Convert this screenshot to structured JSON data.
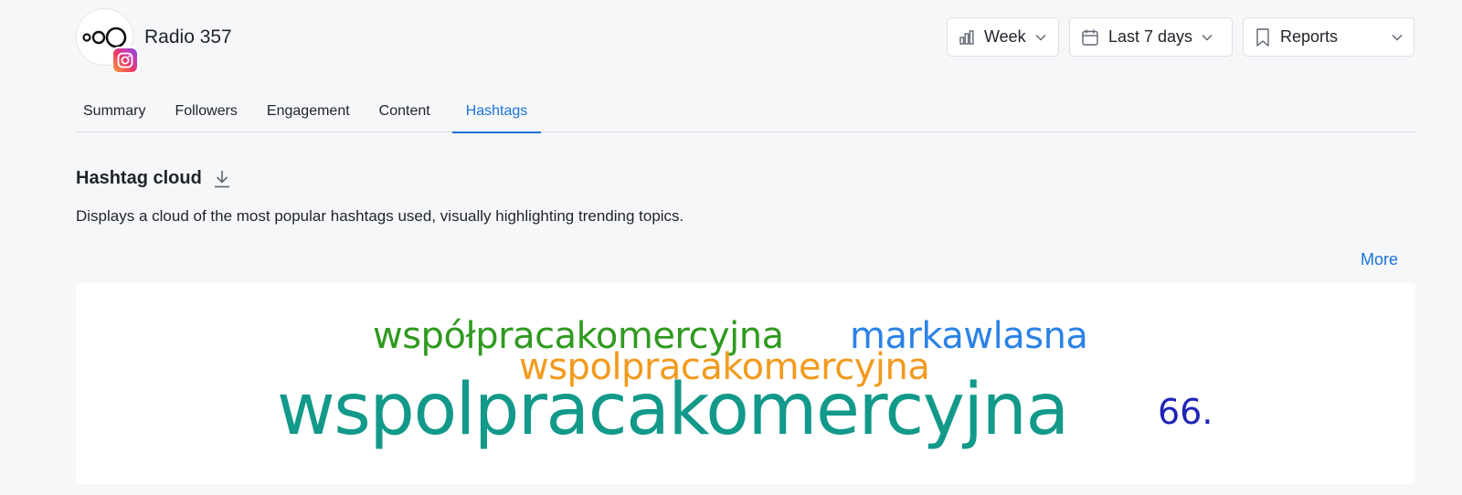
{
  "profile": {
    "name": "Radio 357",
    "avatar_icon": "radio357-logo-icon",
    "network_icon": "instagram-icon"
  },
  "controls": {
    "period": {
      "label": "Week",
      "icon": "bar-chart-icon"
    },
    "range": {
      "label": "Last 7 days",
      "icon": "calendar-icon"
    },
    "reports": {
      "label": "Reports",
      "icon": "bookmark-icon"
    }
  },
  "tabs": [
    {
      "label": "Summary",
      "active": false
    },
    {
      "label": "Followers",
      "active": false
    },
    {
      "label": "Engagement",
      "active": false
    },
    {
      "label": "Content",
      "active": false
    },
    {
      "label": "Hashtags",
      "active": true
    }
  ],
  "section": {
    "title": "Hashtag cloud",
    "description": "Displays a cloud of the most popular hashtags used, visually highlighting trending topics.",
    "more_label": "More"
  },
  "hashtag_cloud": {
    "words": [
      {
        "text": "współpracakomercyjna",
        "color": "#2f9a1f"
      },
      {
        "text": "markawlasna",
        "color": "#2b82e6"
      },
      {
        "text": "wspolpracakomercyjna",
        "color": "#f29a1d"
      },
      {
        "text": "wspolpracakomercyjna",
        "color": "#12998a"
      },
      {
        "text": "66.",
        "color": "#1f24b8"
      }
    ]
  },
  "colors": {
    "accent": "#1a73d9",
    "background": "#f6f7f9"
  }
}
